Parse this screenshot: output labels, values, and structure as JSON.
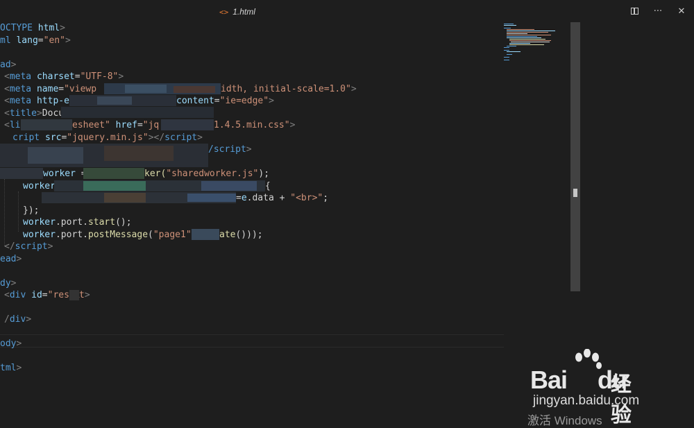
{
  "tab": {
    "icon": "code-icon",
    "filename": "1.html"
  },
  "actions": [
    {
      "name": "split-editor-icon"
    },
    {
      "name": "more-actions-icon",
      "glyph": "···"
    },
    {
      "name": "close-icon",
      "glyph": "✕"
    }
  ],
  "code": {
    "l1": [
      "OCTYPE",
      " html",
      ">"
    ],
    "l2": [
      "ml",
      " lang",
      "=",
      "\"en\"",
      ">"
    ],
    "l4": [
      "ad",
      ">"
    ],
    "l5": [
      "<",
      "meta",
      " charset",
      "=",
      "\"UTF-8\"",
      ">"
    ],
    "l6": [
      "<",
      "meta",
      " name",
      "=",
      "\"viewp",
      "idth, initial-scale=1.0\"",
      ">"
    ],
    "l7": [
      "<",
      "meta",
      " http-equ",
      "content",
      "=",
      "\"ie=edge\"",
      ">"
    ],
    "l8": [
      "<",
      "title",
      ">",
      "Docu"
    ],
    "l9": [
      "<",
      "li",
      "esheet\"",
      " href",
      "=",
      "\"jq",
      "1.4.5.min.css\"",
      ">"
    ],
    "l10": [
      "cript",
      " src",
      "=",
      "\"jquery.min.js\"",
      "></",
      "script",
      ">"
    ],
    "l11": [
      "/script",
      ">"
    ],
    "l13": [
      "worker",
      " = ",
      "ker(",
      "\"sharedworker.js\"",
      ");"
    ],
    "l14": [
      "worker",
      "{"
    ],
    "l15": [
      "=",
      "e",
      ".data + ",
      "\"<br>\"",
      ";"
    ],
    "l16": [
      "});"
    ],
    "l17": [
      "worker",
      ".port.",
      "start",
      "();"
    ],
    "l18": [
      "worker",
      ".port.",
      "postMessage",
      "(",
      "\"page1\"",
      " + ",
      "ate",
      "()));"
    ],
    "l19": [
      "</",
      "script",
      ">"
    ],
    "l20": [
      "ead",
      ">"
    ],
    "l22": [
      "dy",
      ">"
    ],
    "l23": [
      "<",
      "div",
      " id",
      "=",
      "\"resul",
      "t",
      ">"
    ],
    "l25": [
      "/",
      "div",
      ">"
    ],
    "l27": [
      "ody",
      ">"
    ],
    "l29": [
      "tml",
      ">"
    ]
  },
  "watermark": {
    "brand_left": "Bai",
    "brand_mid": "du",
    "brand_cn": "经验",
    "url": "jingyan.baidu.com"
  },
  "os_notice": "激活 Windows"
}
